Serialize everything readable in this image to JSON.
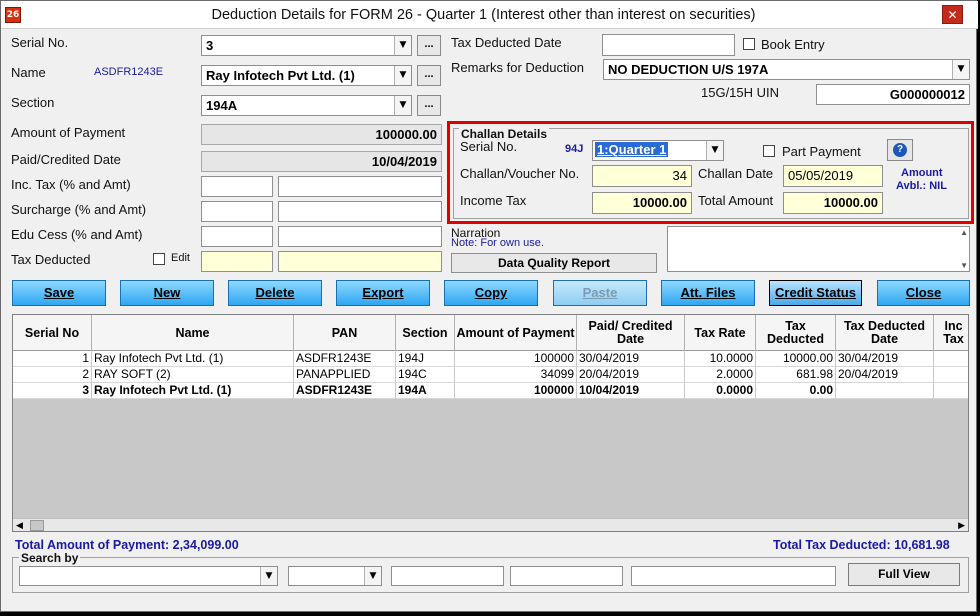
{
  "window": {
    "title": "Deduction Details for FORM 26 - Quarter 1 (Interest other than interest on securities)",
    "app_icon": "26",
    "close_symbol": "✕"
  },
  "form": {
    "serial_label": "Serial No.",
    "serial_value": "3",
    "name_label": "Name",
    "name_pan": "ASDFR1243E",
    "name_value": "Ray Infotech Pvt Ltd. (1)",
    "section_label": "Section",
    "section_value": "194A",
    "amount_label": "Amount of Payment",
    "amount_value": "100000.00",
    "paid_date_label": "Paid/Credited Date",
    "paid_date_value": "10/04/2019",
    "inc_tax_label": "Inc. Tax (% and Amt)",
    "surcharge_label": "Surcharge (% and Amt)",
    "edu_cess_label": "Edu Cess (% and Amt)",
    "tax_deducted_label": "Tax Deducted",
    "edit_label": "Edit",
    "ellipsis": "...",
    "tax_deducted_date_label": "Tax Deducted Date",
    "tax_deducted_date_value": "",
    "book_entry_label": "Book Entry",
    "remarks_label": "Remarks for Deduction",
    "remarks_value": "NO DEDUCTION U/S 197A",
    "uin_label": "15G/15H UIN",
    "uin_value": "G000000012",
    "narration_label": "Narration",
    "narration_note": "Note: For own use.",
    "dq_report_label": "Data Quality Report"
  },
  "challan": {
    "group_label": "Challan Details",
    "serial_label": "Serial No.",
    "serial_code": "94J",
    "serial_value": "1:Quarter 1",
    "part_payment_label": "Part Payment",
    "help_symbol": "?",
    "voucher_label": "Challan/Voucher No.",
    "voucher_value": "34",
    "date_label": "Challan Date",
    "date_value": "05/05/2019",
    "avail_line1": "Amount",
    "avail_line2": "Avbl.: NIL",
    "income_tax_label": "Income Tax",
    "income_tax_value": "10000.00",
    "total_label": "Total Amount",
    "total_value": "10000.00"
  },
  "buttons": {
    "save": "Save",
    "new": "New",
    "delete": "Delete",
    "export": "Export",
    "copy": "Copy",
    "paste": "Paste",
    "att_files": "Att. Files",
    "credit_status": "Credit Status",
    "close": "Close"
  },
  "grid": {
    "columns": [
      "Serial No",
      "Name",
      "PAN",
      "Section",
      "Amount of Payment",
      "Paid/ Credited Date",
      "Tax Rate",
      "Tax Deducted",
      "Tax Deducted Date",
      "Inc Tax"
    ],
    "rows": [
      [
        "1",
        "Ray Infotech Pvt Ltd. (1)",
        "ASDFR1243E",
        "194J",
        "100000",
        "30/04/2019",
        "10.0000",
        "10000.00",
        "30/04/2019",
        ""
      ],
      [
        "2",
        "RAY SOFT (2)",
        "PANAPPLIED",
        "194C",
        "34099",
        "20/04/2019",
        "2.0000",
        "681.98",
        "20/04/2019",
        ""
      ],
      [
        "3",
        "Ray Infotech Pvt Ltd. (1)",
        "ASDFR1243E",
        "194A",
        "100000",
        "10/04/2019",
        "0.0000",
        "0.00",
        "",
        ""
      ]
    ]
  },
  "totals": {
    "payment": "Total Amount of Payment: 2,34,099.00",
    "tax": "Total Tax Deducted: 10,681.98"
  },
  "search": {
    "label": "Search by",
    "full_view": "Full View"
  },
  "colors": {
    "accent_blue": "#1a1aa6",
    "button_blue": "#2fa7f2",
    "highlight_red": "#e10000",
    "field_yellow": "#ffffd8"
  }
}
